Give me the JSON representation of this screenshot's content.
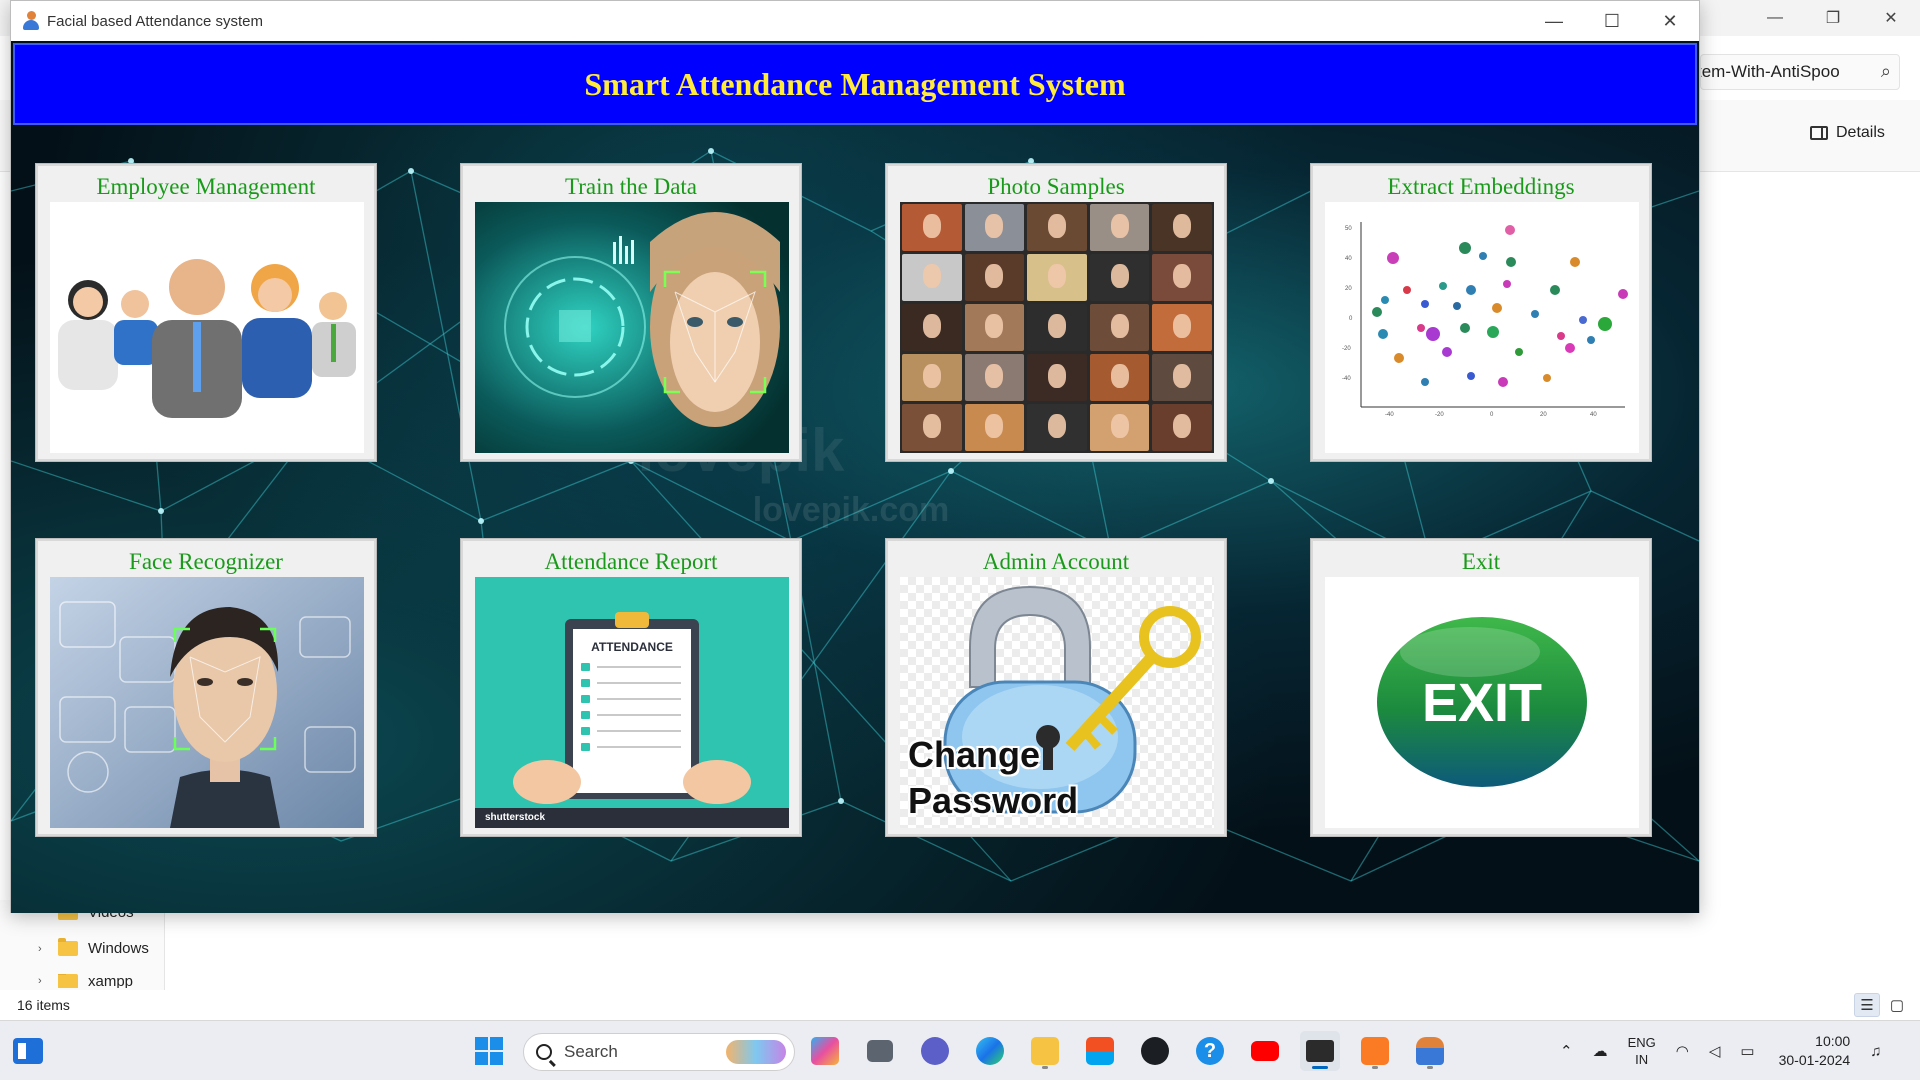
{
  "explorer": {
    "address_text": "tem-With-AntiSpoo",
    "details_label": "Details",
    "nav_items": [
      {
        "label": "Videos"
      },
      {
        "label": "Windows"
      },
      {
        "label": "xampp"
      }
    ],
    "status": "16 items"
  },
  "app": {
    "window_title": "Facial based Attendance system",
    "banner_title": "Smart Attendance Management System",
    "tiles": [
      {
        "label": "Employee Management"
      },
      {
        "label": "Train the Data"
      },
      {
        "label": "Photo Samples"
      },
      {
        "label": "Extract Embeddings"
      },
      {
        "label": "Face Recognizer"
      },
      {
        "label": "Attendance Report",
        "image_text": "ATTENDANCE",
        "watermark": "shutterstock"
      },
      {
        "label": "Admin Account",
        "image_text_line1": "Change",
        "image_text_line2": "Password"
      },
      {
        "label": "Exit",
        "image_text": "EXIT"
      }
    ],
    "background_watermark_line1": "lovepik",
    "background_watermark_line2": "lovepik.com"
  },
  "taskbar": {
    "search_placeholder": "Search",
    "language_line1": "ENG",
    "language_line2": "IN",
    "time": "10:00",
    "date": "30-01-2024"
  },
  "colors": {
    "banner_bg": "#0000ff",
    "banner_text": "#ffeb3b",
    "tile_title": "#1a9a1a",
    "canvas_bg": "#041018",
    "exit_green": "#1c8a3e"
  }
}
